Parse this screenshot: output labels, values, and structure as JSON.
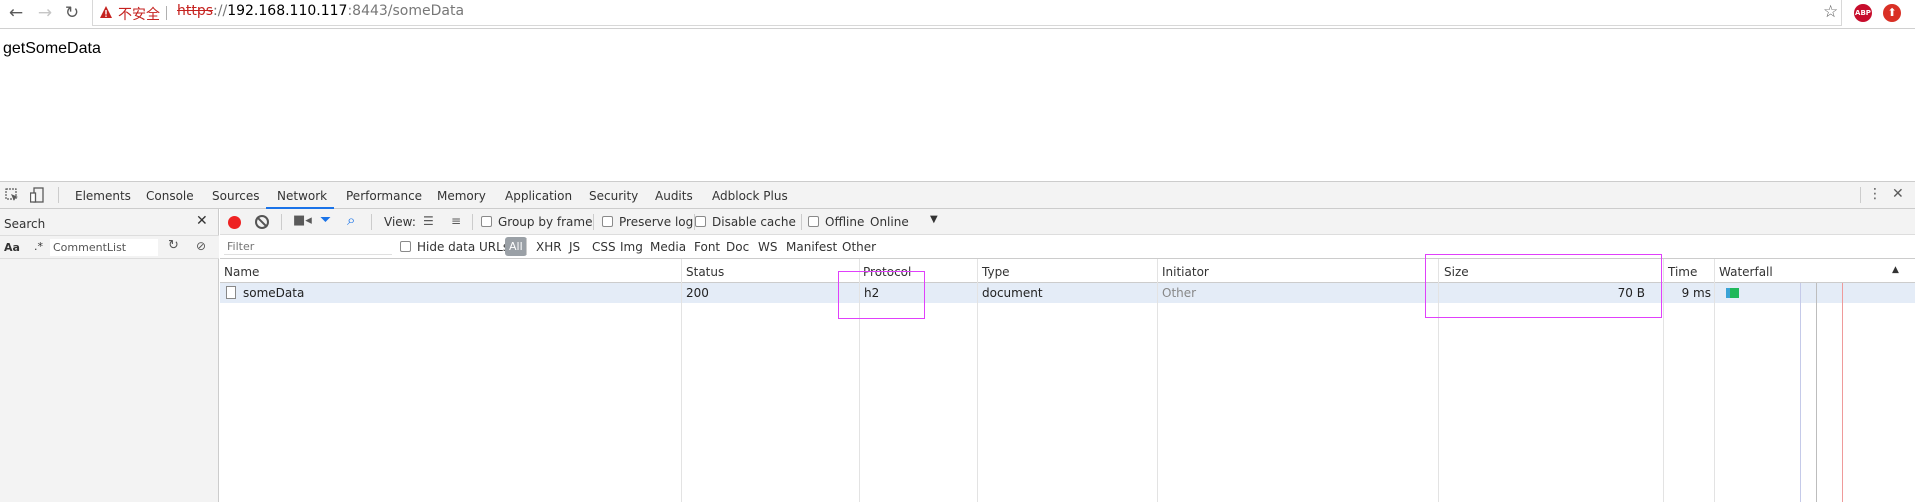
{
  "browser": {
    "insecure_label": "不安全",
    "url_scheme": "https",
    "url_sep": "://",
    "url_host": "192.168.110.117",
    "url_rest": ":8443/someData",
    "abp_label": "ABP"
  },
  "page": {
    "text": "getSomeData"
  },
  "devtools": {
    "tabs": [
      "Elements",
      "Console",
      "Sources",
      "Network",
      "Performance",
      "Memory",
      "Application",
      "Security",
      "Audits",
      "Adblock Plus"
    ],
    "active_tab": "Network",
    "search": {
      "title": "Search",
      "case_label": "Aa",
      "regex_label": ".*",
      "query": "CommentList"
    },
    "toolbar": {
      "view_label": "View:",
      "group_by_frame": "Group by frame",
      "preserve_log": "Preserve log",
      "disable_cache": "Disable cache",
      "offline": "Offline",
      "throttle": "Online"
    },
    "filter": {
      "placeholder": "Filter",
      "hide_data_urls": "Hide data URLs",
      "types": [
        "All",
        "XHR",
        "JS",
        "CSS",
        "Img",
        "Media",
        "Font",
        "Doc",
        "WS",
        "Manifest",
        "Other"
      ]
    },
    "table": {
      "columns": [
        "Name",
        "Status",
        "Protocol",
        "Type",
        "Initiator",
        "Size",
        "Time",
        "Waterfall"
      ],
      "rows": [
        {
          "name": "someData",
          "status": "200",
          "protocol": "h2",
          "type": "document",
          "initiator": "Other",
          "size": "70 B",
          "time": "9 ms"
        }
      ]
    }
  },
  "colors": {
    "record": "#ee2222",
    "accent": "#1a73e8",
    "annotation": "#e040fb",
    "selected_row": "#e4ecf7"
  }
}
